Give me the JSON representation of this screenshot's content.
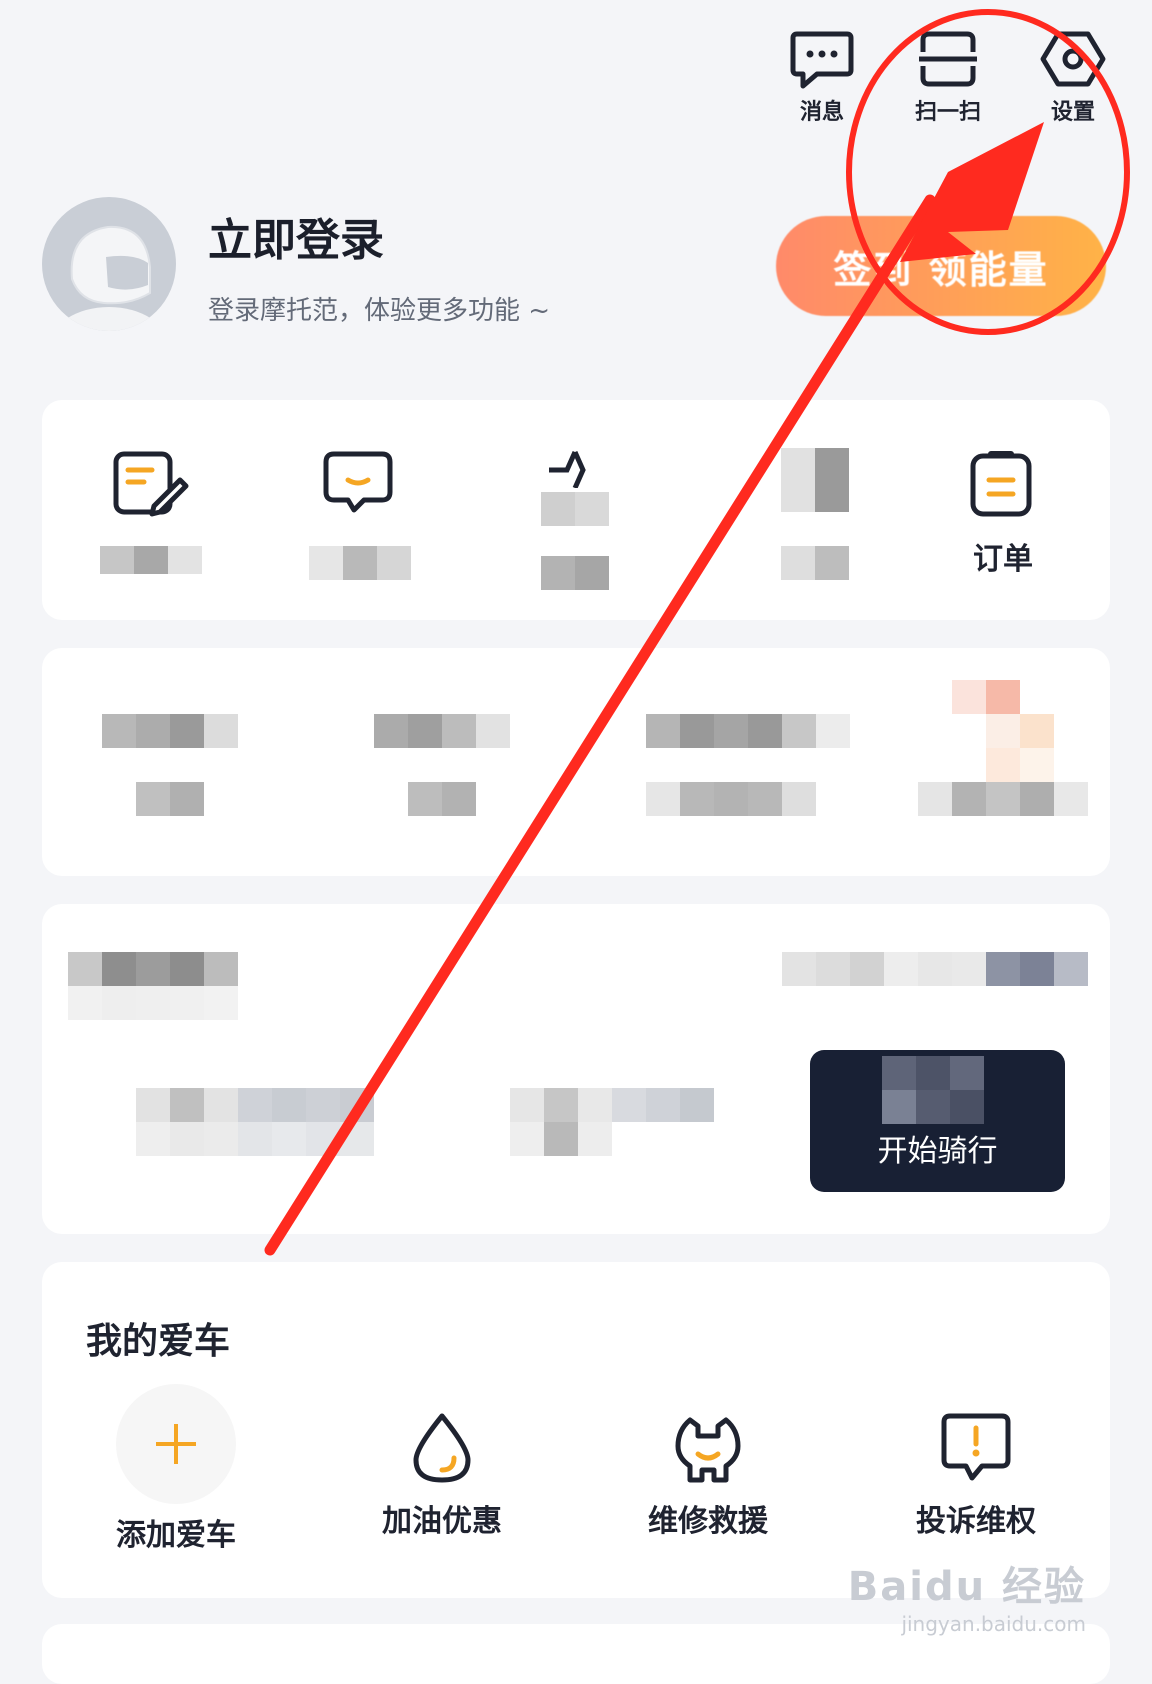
{
  "header": {
    "messages_label": "消息",
    "scan_label": "扫一扫",
    "settings_label": "设置"
  },
  "profile": {
    "title": "立即登录",
    "subtitle": "登录摩托范，体验更多功能 ~",
    "signin_button": "签到 领能量"
  },
  "quick_actions": {
    "items": [
      {
        "label": "",
        "icon": "edit-note-icon"
      },
      {
        "label": "",
        "icon": "chat-icon"
      },
      {
        "label": "",
        "icon": "star-icon"
      },
      {
        "label": "",
        "icon": "history-icon"
      },
      {
        "label": "订单",
        "icon": "order-icon"
      }
    ]
  },
  "ride": {
    "start_label": "开始骑行"
  },
  "my_car": {
    "title": "我的爱车",
    "items": [
      {
        "label": "添加爱车",
        "icon": "plus-icon"
      },
      {
        "label": "加油优惠",
        "icon": "fuel-drop-icon"
      },
      {
        "label": "维修救援",
        "icon": "wrench-icon"
      },
      {
        "label": "投诉维权",
        "icon": "complaint-icon"
      }
    ]
  },
  "watermark": {
    "line1": "Baidu 经验",
    "line2": "jingyan.baidu.com"
  },
  "colors": {
    "accent": "#f5a623",
    "annotation": "#ff2a1f",
    "ride_bg": "#182034"
  }
}
